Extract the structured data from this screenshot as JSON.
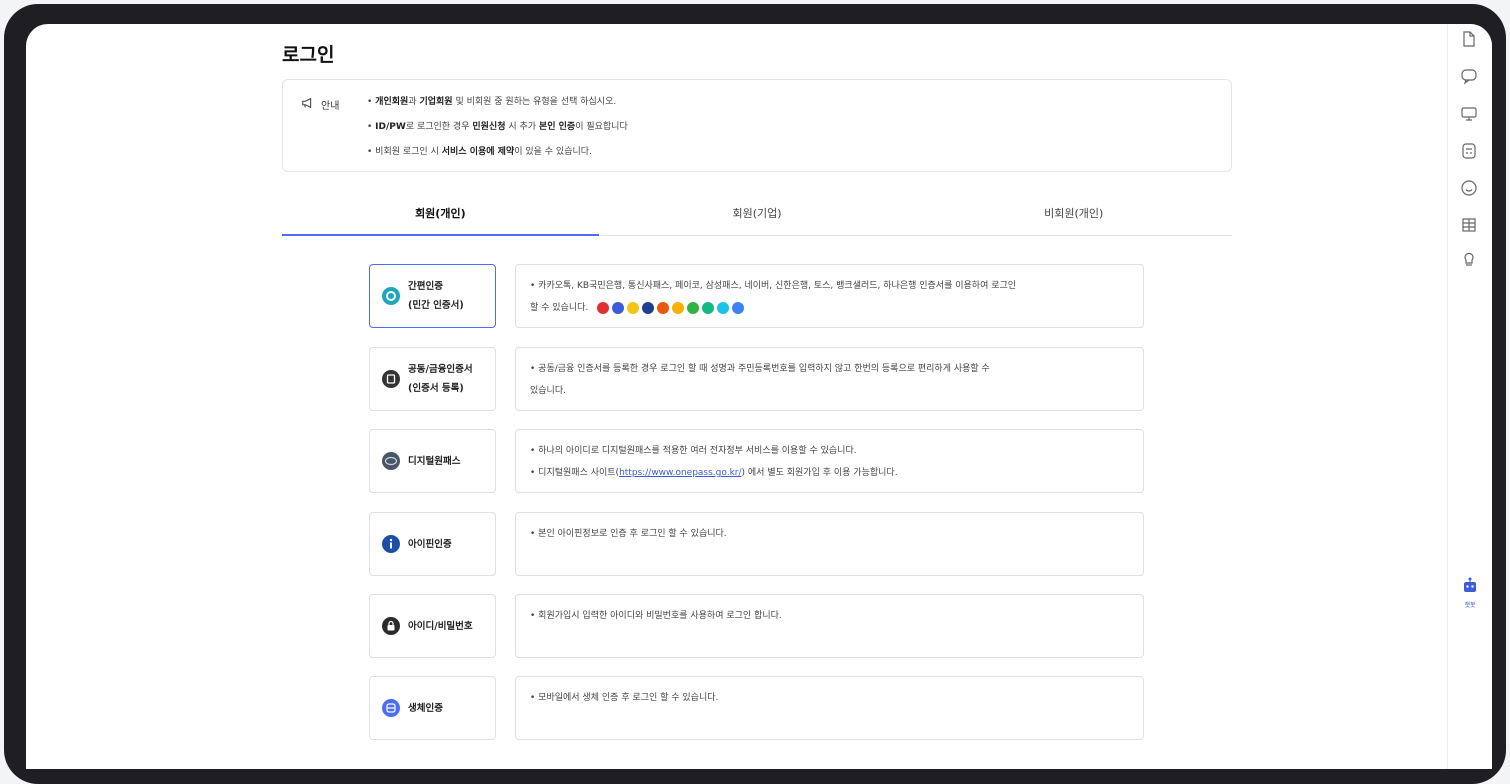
{
  "page": {
    "title": "로그인"
  },
  "notice": {
    "label": "안내",
    "items": [
      {
        "before": "• ",
        "bold1": "개인회원",
        "mid1": "과 ",
        "bold2": "기업회원",
        "after": " 및 비회원 중 원하는 유형을 선택 하십시오."
      },
      {
        "before": "• ",
        "bold1": "ID/PW",
        "mid1": "로 로그인한 경우 ",
        "bold2": "민원신청",
        "mid2": " 시 추가 ",
        "bold3": "본인 인증",
        "after": "이 필요합니다"
      },
      {
        "before": "• 비회원 로그인 시 ",
        "bold1": "서비스 이용에 제약",
        "after": "이 있을 수 있습니다."
      }
    ]
  },
  "tabs": [
    {
      "label": "회원(개인)",
      "active": true
    },
    {
      "label": "회원(기업)",
      "active": false
    },
    {
      "label": "비회원(개인)",
      "active": false
    }
  ],
  "methods": [
    {
      "label": "간편인증\n(민간 인증서)",
      "icon": "simple-auth-icon",
      "color": "#1aa8b8",
      "lines": [
        "• 카카오톡, KB국민은행, 통신사패스, 페이코, 삼성패스, 네이버, 신한은행, 토스, 뱅크샐러드, 하나은행 인증서를 이용하여 로그인",
        "할 수 있습니다."
      ]
    },
    {
      "label": "공동/금융인증서\n(인증서 등록)",
      "icon": "certificate-icon",
      "color": "#333333",
      "lines": [
        "• 공동/금융 인증서를 등록한 경우 로그인 할 때 성명과 주민등록번호를 입력하지 않고 한번의 등록으로 편리하게 사용할 수",
        "있습니다."
      ]
    },
    {
      "label": "디지털원패스",
      "icon": "onepass-icon",
      "color": "#4a5568",
      "lines": [
        "• 하나의 아이디로 디지털원패스를 적용한 여러 전자정부 서비스를 이용할 수 있습니다."
      ],
      "link_line": {
        "before": "• 디지털원패스 사이트(",
        "link": "https://www.onepass.go.kr/",
        "after": ") 에서 별도 회원가입 후 이용 가능합니다."
      }
    },
    {
      "label": "아이핀인증",
      "icon": "ipin-icon",
      "color": "#1e4fa8",
      "lines": [
        "• 본인 아이핀정보로 인증 후 로그인 할 수 있습니다."
      ]
    },
    {
      "label": "아이디/비밀번호",
      "icon": "lock-icon",
      "color": "#2b2b2b",
      "lines": [
        "• 회원가입시 입력한 아이디와 비밀번호를 사용하여 로그인 합니다."
      ]
    },
    {
      "label": "생체인증",
      "icon": "biometric-icon",
      "color": "#4c6ef5",
      "lines": [
        "• 모바일에서 생체 인증 후 로그인 할 수 있습니다."
      ]
    }
  ],
  "provider_logos": [
    "#e03131",
    "#3b5bdb",
    "#f5c518",
    "#1c3f94",
    "#e8590c",
    "#fab005",
    "#2fb344",
    "#12b886",
    "#1cc3e8",
    "#3b82f6"
  ],
  "sidebar": {
    "icons": [
      "document-icon",
      "chat-bubble-icon",
      "monitor-icon",
      "calculator-icon",
      "smile-icon",
      "grid-icon",
      "lightbulb-icon"
    ],
    "chatbot_label": "챗봇"
  }
}
